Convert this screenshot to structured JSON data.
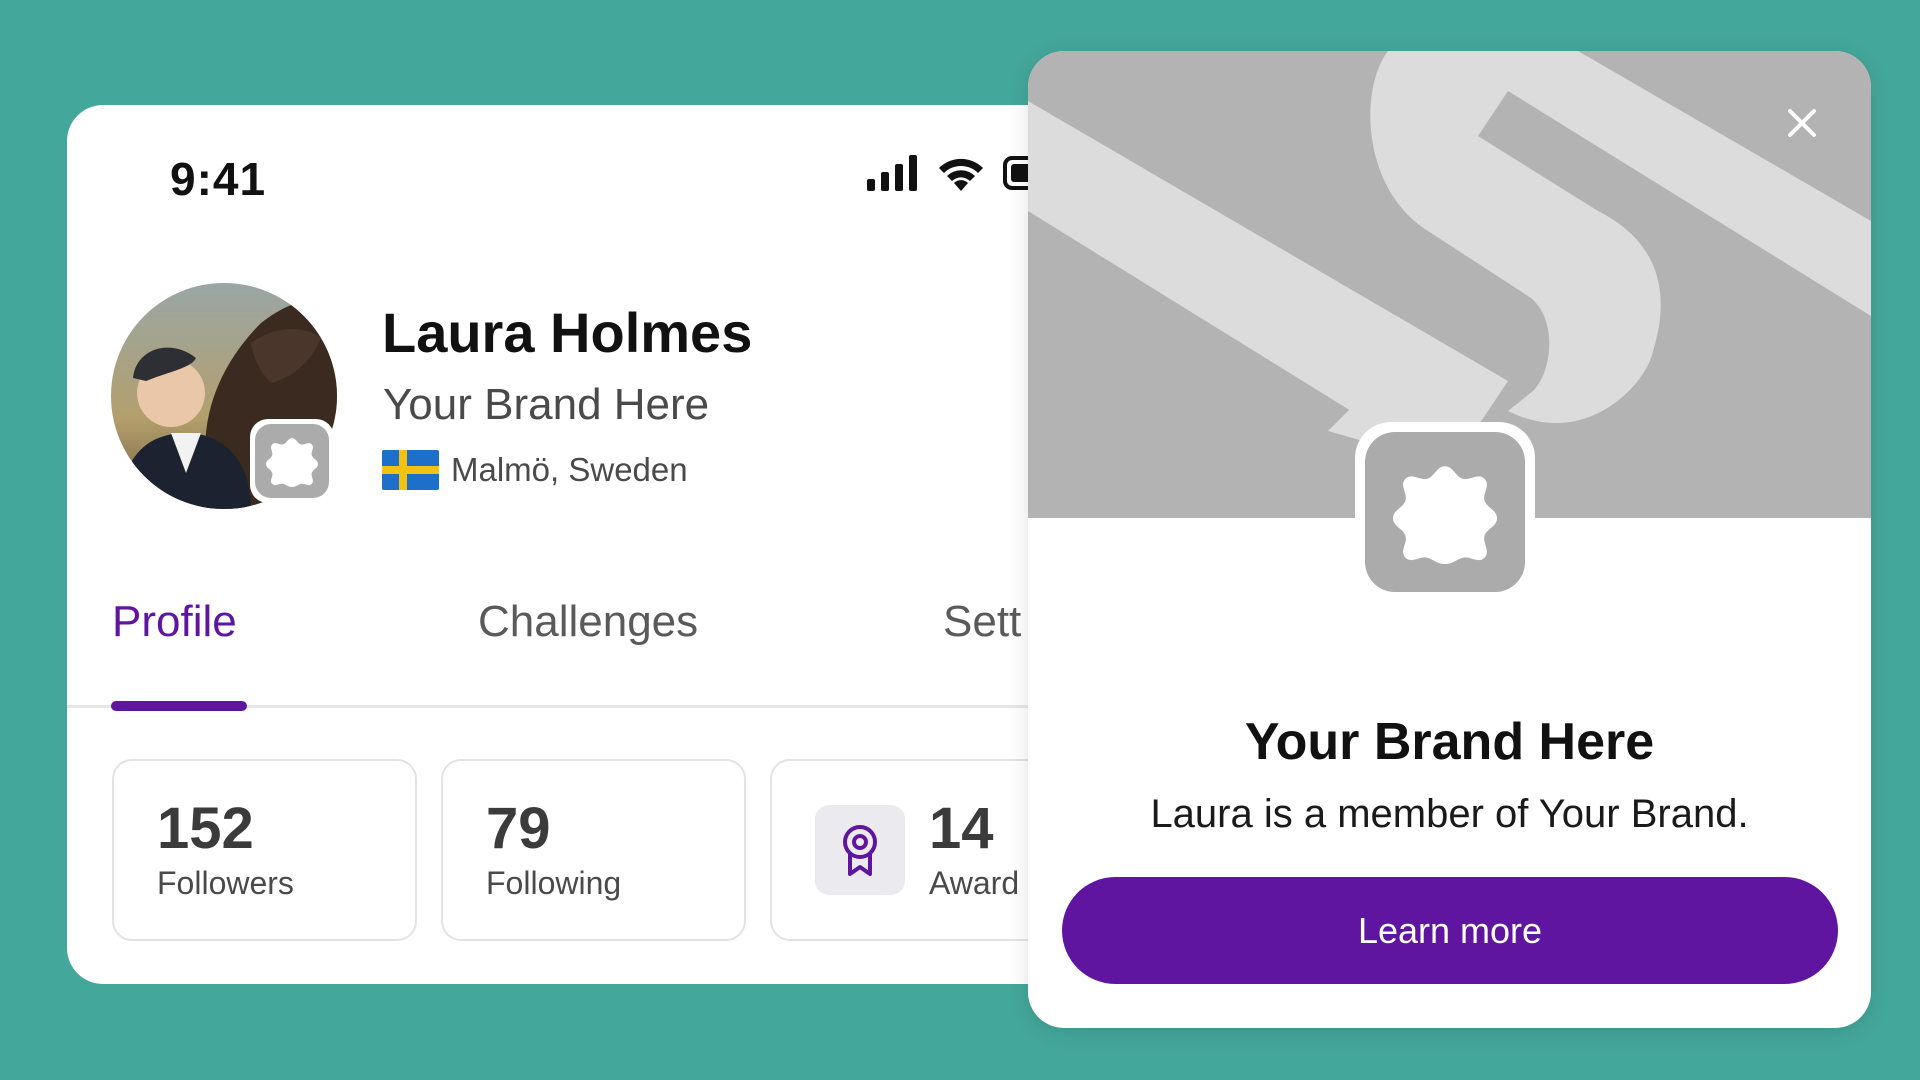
{
  "status_bar": {
    "time": "9:41",
    "signal_icon": "signal-bars-icon",
    "wifi_icon": "wifi-icon",
    "battery_icon": "battery-icon"
  },
  "profile": {
    "name": "Laura Holmes",
    "brand": "Your Brand Here",
    "location": "Malmö, Sweden",
    "flag_icon": "sweden-flag-icon"
  },
  "tabs": [
    {
      "label": "Profile",
      "active": true
    },
    {
      "label": "Challenges",
      "active": false
    },
    {
      "label": "Sett",
      "active": false
    }
  ],
  "stats": [
    {
      "value": "152",
      "label": "Followers"
    },
    {
      "value": "79",
      "label": "Following"
    },
    {
      "value": "14",
      "label": "Award",
      "icon": "award-ribbon-icon"
    }
  ],
  "popup": {
    "title": "Your Brand Here",
    "text": "Laura is a member of Your Brand.",
    "button_label": "Learn more",
    "close_icon": "close-icon",
    "logo_icon": "brand-badge-icon"
  },
  "colors": {
    "background": "#44a79b",
    "accent": "#5f15a0",
    "banner_gray": "#b3b3b3",
    "banner_light": "#dcdcdc",
    "badge_gray": "#ababab"
  }
}
